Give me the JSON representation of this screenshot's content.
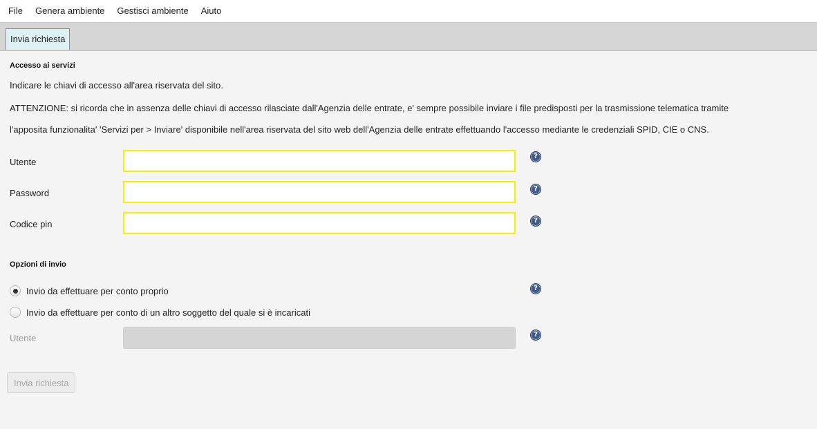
{
  "menubar": {
    "items": [
      "File",
      "Genera ambiente",
      "Gestisci ambiente",
      "Aiuto"
    ]
  },
  "tabs": [
    {
      "label": "Invia richiesta",
      "active": true
    }
  ],
  "access": {
    "section_title": "Accesso ai servizi",
    "intro": "Indicare le chiavi di accesso all'area riservata del sito.",
    "warning_line1": "ATTENZIONE: si ricorda che in assenza delle chiavi di accesso rilasciate dall'Agenzia delle entrate, e' sempre possibile inviare i file predisposti per la trasmissione telematica tramite",
    "warning_line2": "l'apposita funzionalita' 'Servizi per > Inviare' disponibile nell'area riservata del sito web dell'Agenzia delle entrate effettuando l'accesso mediante le credenziali SPID, CIE o CNS.",
    "fields": {
      "utente": {
        "label": "Utente",
        "value": ""
      },
      "password": {
        "label": "Password",
        "value": ""
      },
      "pin": {
        "label": "Codice pin",
        "value": ""
      }
    }
  },
  "options": {
    "section_title": "Opzioni di invio",
    "radio_own": {
      "label": "Invio da effettuare per conto proprio",
      "checked": true
    },
    "radio_other": {
      "label": "Invio da effettuare per conto di un altro soggetto del quale si è incaricati",
      "checked": false
    },
    "delegate_user": {
      "label": "Utente",
      "value": "",
      "enabled": false
    }
  },
  "submit_button": {
    "label": "Invia richiesta",
    "enabled": false
  },
  "help_icon_glyph": "?",
  "colors": {
    "required_border": "#f5f000",
    "tab_active": "#dff1f3",
    "help_icon": "#3f5a86"
  }
}
